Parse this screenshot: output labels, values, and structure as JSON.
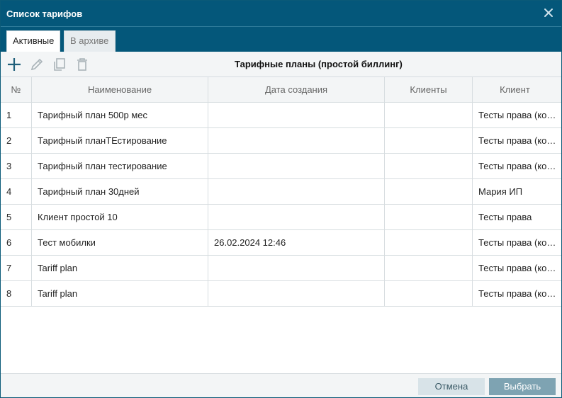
{
  "window": {
    "title": "Список тарифов"
  },
  "tabs": [
    {
      "label": "Активные",
      "active": true
    },
    {
      "label": "В архиве",
      "active": false
    }
  ],
  "toolbar": {
    "caption": "Тарифные планы (простой биллинг)",
    "icons": [
      "plus-icon",
      "pencil-icon",
      "copy-icon",
      "trash-icon"
    ]
  },
  "table": {
    "columns": [
      "№",
      "Наименование",
      "Дата создания",
      "Клиенты",
      "Клиент"
    ],
    "rows": [
      [
        "1",
        "Тарифный план 500р мес",
        "",
        "",
        "Тесты права (копия)"
      ],
      [
        "2",
        "Тарифный планТЕстирование",
        "",
        "",
        "Тесты права (копия)"
      ],
      [
        "3",
        "Тарифный план тестирование",
        "",
        "",
        "Тесты права (копия)"
      ],
      [
        "4",
        "Тарифный план 30дней",
        "",
        "",
        "Мария ИП"
      ],
      [
        "5",
        "Клиент простой 10",
        "",
        "",
        "Тесты права"
      ],
      [
        "6",
        "Тест мобилки",
        "26.02.2024 12:46",
        "",
        "Тесты права (копия)"
      ],
      [
        "7",
        "Tariff plan",
        "",
        "",
        "Тесты права (копия)"
      ],
      [
        "8",
        "Tariff plan",
        "",
        "",
        "Тесты права (копия)"
      ]
    ]
  },
  "footer": {
    "cancel_label": "Отмена",
    "select_label": "Выбрать"
  },
  "colors": {
    "titlebar": "#04577a",
    "accent_button": "#7ea3b2",
    "secondary_button": "#d8e3e8"
  }
}
